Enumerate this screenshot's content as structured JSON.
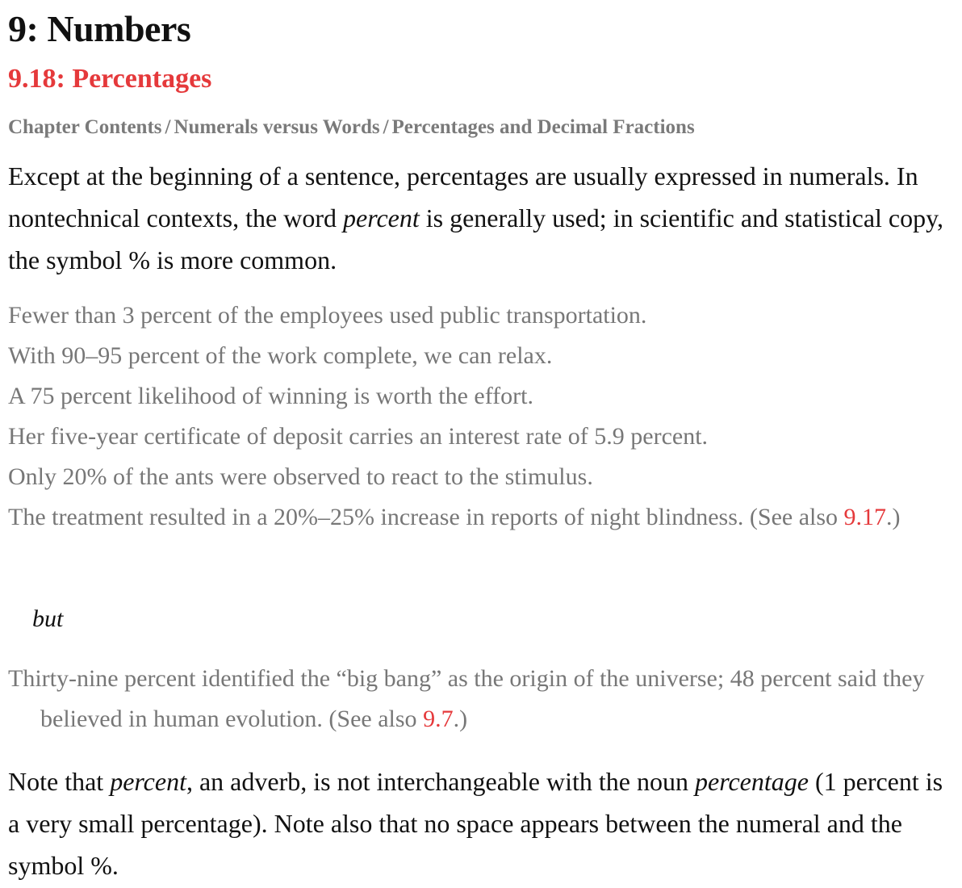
{
  "chapter_title": "9: Numbers",
  "section_title": "9.18: Percentages",
  "breadcrumb": {
    "items": [
      "Chapter Contents",
      "Numerals versus Words",
      "Percentages and Decimal Fractions"
    ],
    "separator": "/"
  },
  "intro": {
    "part1": "Except at the beginning of a sentence, percentages are usually expressed in numerals. In nontechnical contexts, the word ",
    "em1": "percent",
    "part2": " is generally used; in scientific and statistical copy, the symbol % is more common."
  },
  "examples_1": [
    "Fewer than 3 percent of the employees used public transportation.",
    "With 90–95 percent of the work complete, we can relax.",
    "A 75 percent likelihood of winning is worth the effort.",
    "Her five-year certificate of deposit carries an interest rate of 5.9 percent.",
    "Only 20% of the ants were observed to react to the stimulus."
  ],
  "example_6": {
    "text": "The treatment resulted in a 20%–25% increase in reports of night blindness. (See also ",
    "link": "9.17",
    "after": ".)"
  },
  "but_label": "but",
  "example_7": {
    "text": "Thirty-nine percent identified the “big bang” as the origin of the universe; 48 percent said they believed in human evolution. (See also ",
    "link": "9.7",
    "after": ".)"
  },
  "note": {
    "part1": "Note that ",
    "em1": "percent",
    "part2": ", an adverb, is not interchangeable with the noun ",
    "em2": "percentage",
    "part3": " (1 percent is a very small percentage). Note also that no space appears between the numeral and the symbol %."
  },
  "colors": {
    "accent": "#e5393b",
    "example_text": "#777777",
    "breadcrumb": "#7a7a7a"
  }
}
